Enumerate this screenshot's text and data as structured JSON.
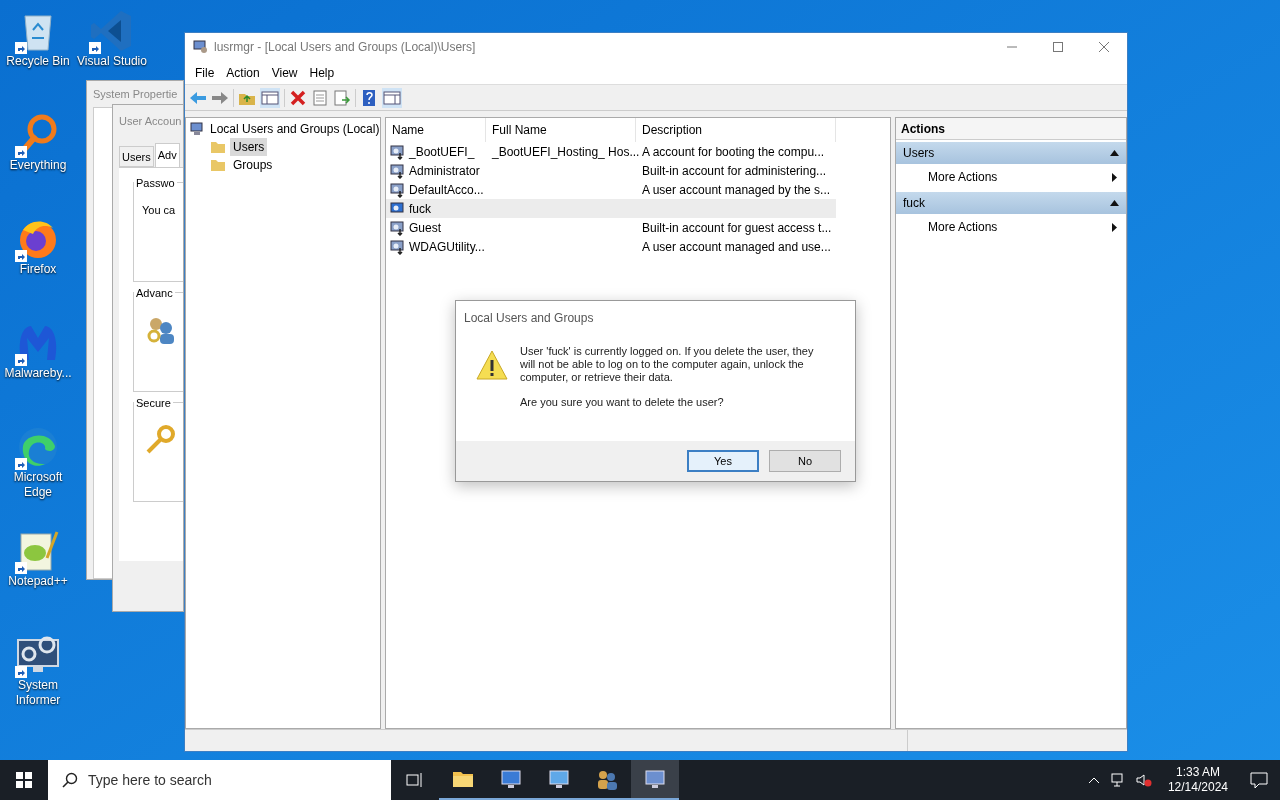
{
  "desktop_icons": [
    {
      "label": "Recycle Bin",
      "kind": "recycle"
    },
    {
      "label": "Visual Studio",
      "kind": "vscode"
    },
    {
      "label": "Everything",
      "kind": "search"
    },
    {
      "label": "Firefox",
      "kind": "firefox"
    },
    {
      "label": "Malwareby...",
      "kind": "malware"
    },
    {
      "label": "Microsoft Edge",
      "kind": "edge"
    },
    {
      "label": "Notepad++",
      "kind": "notepad"
    },
    {
      "label": "System Informer",
      "kind": "monitor"
    }
  ],
  "background_windows": [
    {
      "title": "System Propertie"
    },
    {
      "title": "User Accoun",
      "tabs": [
        {
          "label": "Users",
          "selected": false
        },
        {
          "label": "Adv",
          "selected": true
        }
      ],
      "groups": [
        {
          "title": "Passwo",
          "text": "You ca",
          "kind": "text"
        },
        {
          "title": "Advanc",
          "kind": "users"
        },
        {
          "title": "Secure",
          "kind": "key"
        }
      ]
    }
  ],
  "window": {
    "title": "lusrmgr - [Local Users and Groups (Local)\\Users]"
  },
  "menu": [
    "File",
    "Action",
    "View",
    "Help"
  ],
  "tree": {
    "label": "Local Users and Groups (Local)",
    "children": [
      {
        "label": "Users",
        "selected": true
      },
      {
        "label": "Groups",
        "selected": false
      }
    ]
  },
  "table": {
    "columns": [
      "Name",
      "Full Name",
      "Description"
    ],
    "rows": [
      {
        "name": "_BootUEFI_",
        "full_name": "_BootUEFI_Hosting_ Hos...",
        "description": "A account for booting the compu...",
        "selected": false,
        "disabled": true
      },
      {
        "name": "Administrator",
        "full_name": "",
        "description": "Built-in account for administering...",
        "selected": false,
        "disabled": true
      },
      {
        "name": "DefaultAcco...",
        "description": "A user account managed by the s...",
        "selected": false,
        "disabled": true
      },
      {
        "name": "fuck",
        "description": "",
        "selected": true,
        "disabled": false
      },
      {
        "name": "Guest",
        "description": "Built-in account for guest access t...",
        "selected": false,
        "disabled": true
      },
      {
        "name": "WDAGUtility...",
        "description": "A user account managed and use...",
        "selected": false,
        "disabled": true
      }
    ]
  },
  "actions": {
    "title": "Actions",
    "sections": [
      {
        "title": "Users",
        "items": [
          "More Actions"
        ]
      },
      {
        "title": "fuck",
        "items": [
          "More Actions"
        ]
      }
    ]
  },
  "dialog": {
    "title": "Local Users and Groups",
    "message": "User 'fuck' is currently logged on. If you delete the user, they will not be able to log on to the computer again, unlock the computer, or retrieve their data.",
    "question": "Are you sure you want to delete the user?",
    "buttons": [
      {
        "label": "Yes",
        "selected": true
      },
      {
        "label": "No",
        "selected": false
      }
    ]
  },
  "taskbar": {
    "search_placeholder": "Type here to search",
    "apps": [
      {
        "kind": "folder",
        "selected": false
      },
      {
        "kind": "monitor",
        "selected": false
      },
      {
        "kind": "panel",
        "selected": false
      },
      {
        "kind": "users",
        "selected": false
      },
      {
        "kind": "lusr",
        "selected": true
      }
    ],
    "time": "1:33 AM",
    "date": "12/14/2024"
  }
}
